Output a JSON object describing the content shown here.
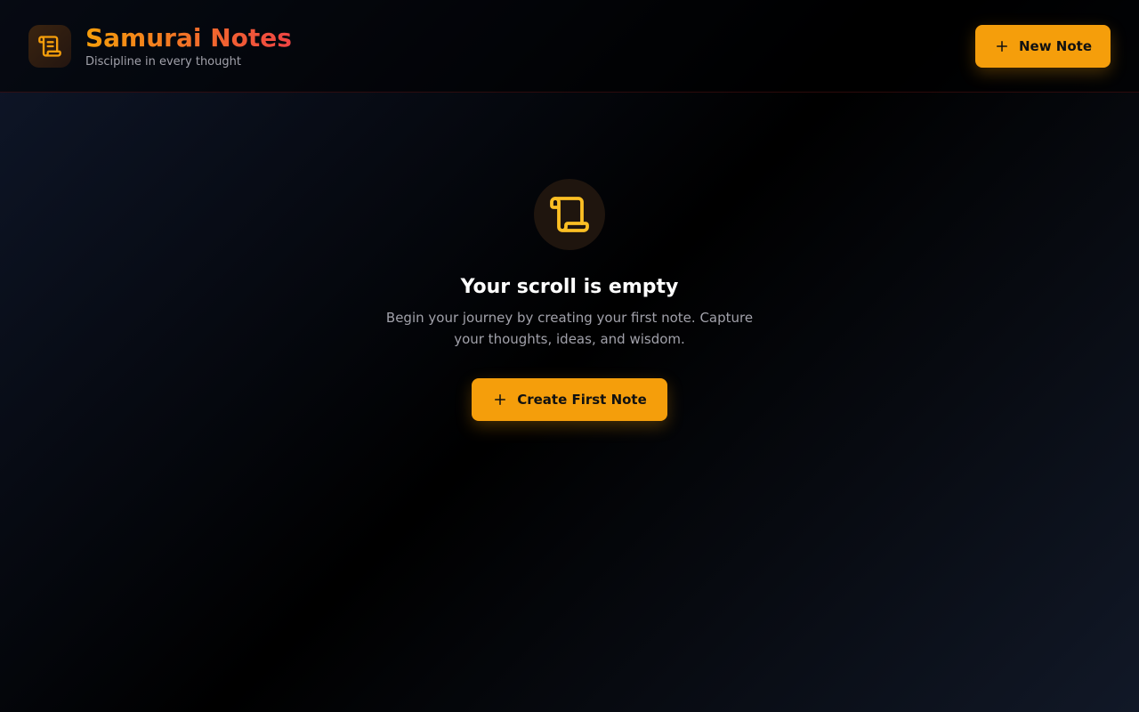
{
  "app": {
    "title": "Samurai Notes",
    "subtitle": "Discipline in every thought",
    "logo_icon": "scroll-icon"
  },
  "header": {
    "new_note_label": "New Note",
    "new_note_icon": "plus-icon"
  },
  "empty_state": {
    "icon": "scroll-icon",
    "title": "Your scroll is empty",
    "description": "Begin your journey by creating your first note. Capture your thoughts, ideas, and wisdom.",
    "cta_label": "Create First Note",
    "cta_icon": "plus-icon"
  },
  "colors": {
    "accent": "#f59e0b",
    "title_gradient_start": "#f59e0b",
    "title_gradient_end": "#ef4444",
    "background": "#000000"
  }
}
